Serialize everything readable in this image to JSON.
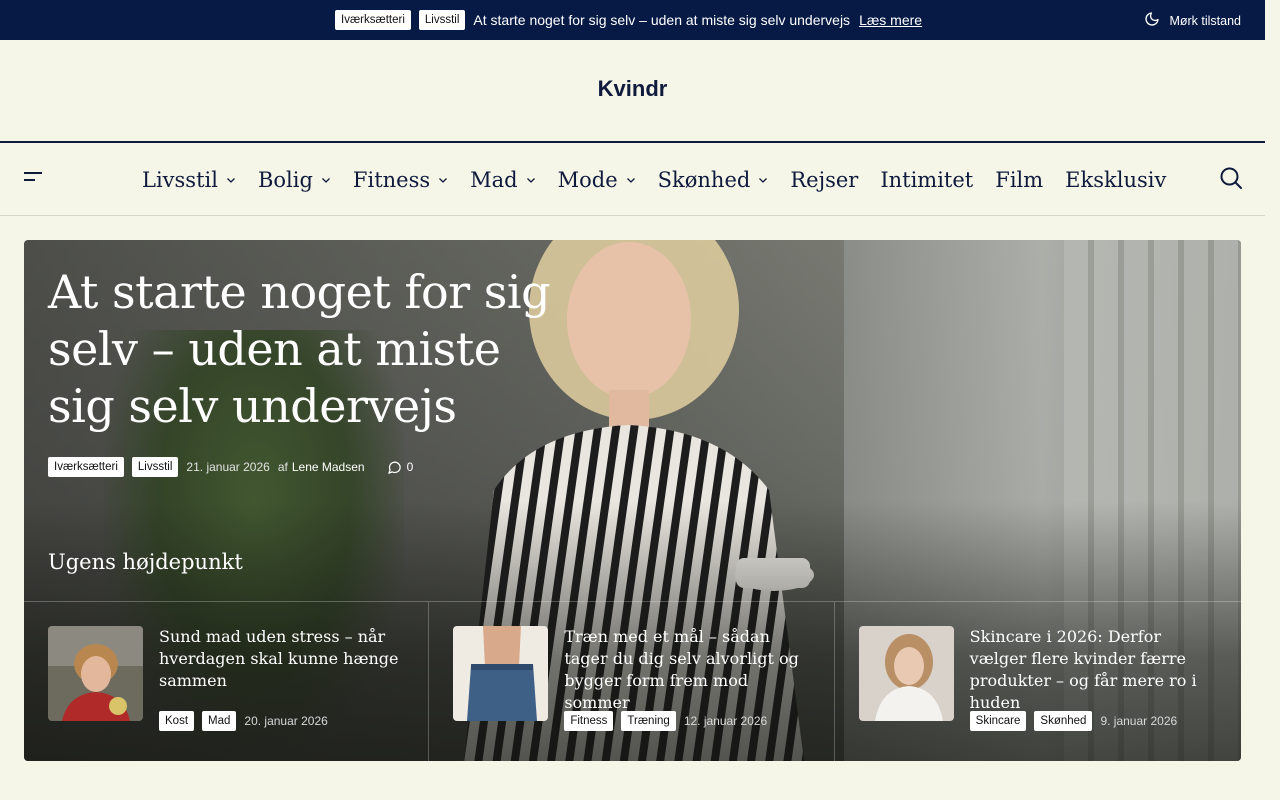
{
  "topbar": {
    "tags": [
      "Iværksætteri",
      "Livsstil"
    ],
    "headline": "At starte noget for sig selv – uden at miste sig selv undervejs",
    "more_label": "Læs mere",
    "dark_mode_label": "Mørk tilstand",
    "dark_mode_icon": "moon-icon",
    "background": "#061a45"
  },
  "site": {
    "brand": "Kvindr",
    "background": "#f5f6e8",
    "text_color": "#0f1a3d"
  },
  "nav": {
    "menu_icon": "hamburger-icon",
    "search_icon": "search-icon",
    "items": [
      {
        "label": "Livsstil",
        "has_dropdown": true
      },
      {
        "label": "Bolig",
        "has_dropdown": true
      },
      {
        "label": "Fitness",
        "has_dropdown": true
      },
      {
        "label": "Mad",
        "has_dropdown": true
      },
      {
        "label": "Mode",
        "has_dropdown": true
      },
      {
        "label": "Skønhed",
        "has_dropdown": true
      },
      {
        "label": "Rejser",
        "has_dropdown": false
      },
      {
        "label": "Intimitet",
        "has_dropdown": false
      },
      {
        "label": "Film",
        "has_dropdown": false
      },
      {
        "label": "Eksklusiv",
        "has_dropdown": false
      }
    ]
  },
  "hero": {
    "title": "At starte noget for sig selv – uden at miste sig selv undervejs",
    "tags": [
      "Iværksætteri",
      "Livsstil"
    ],
    "date": "21. januar 2026",
    "by": "af",
    "author": "Lene Madsen",
    "comments": "0",
    "comment_icon": "comment-icon"
  },
  "highlights": {
    "title": "Ugens højdepunkt",
    "cards": [
      {
        "title": "Sund mad uden stress – når hverdagen skal kunne hænge sammen",
        "tags": [
          "Kost",
          "Mad"
        ],
        "date": "20. januar 2026"
      },
      {
        "title": "Træn med et mål – sådan tager du dig selv alvorligt og bygger form frem mod sommer",
        "tags": [
          "Fitness",
          "Træning"
        ],
        "date": "12. januar 2026"
      },
      {
        "title": "Skincare i 2026: Derfor vælger flere kvinder færre produkter – og får mere ro i huden",
        "tags": [
          "Skincare",
          "Skønhed"
        ],
        "date": "9. januar 2026"
      }
    ]
  }
}
